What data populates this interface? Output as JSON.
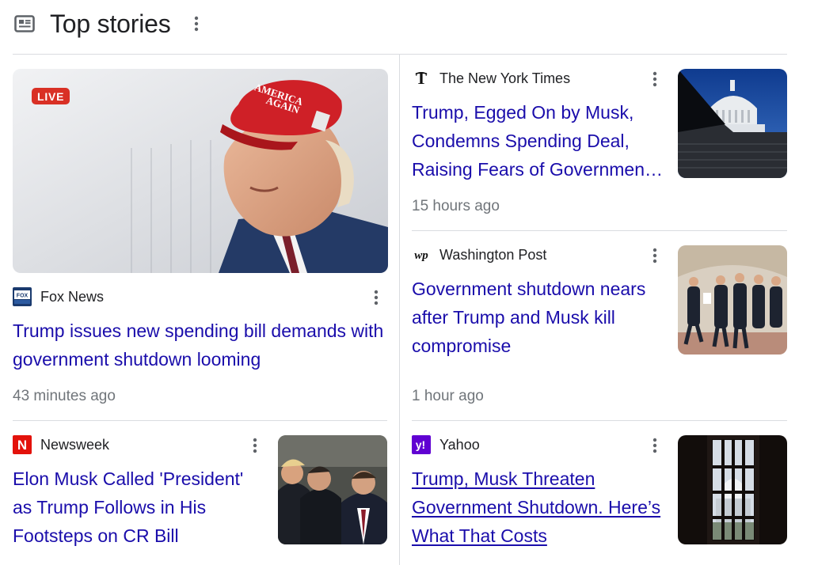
{
  "section": {
    "title": "Top stories",
    "icon": "newspaper-icon"
  },
  "stories": [
    {
      "id": "fox",
      "badge": "LIVE",
      "source": "Fox News",
      "source_icon": "fox-news-logo",
      "headline": "Trump issues new spending bill demands with government shutdown looming",
      "time": "43 minutes ago",
      "image": "trump-maga-cap-photo"
    },
    {
      "id": "nyt",
      "source": "The New York Times",
      "source_icon": "nyt-logo",
      "headline": "Trump, Egged On by Musk, Condemns Spending Deal, Raising Fears of Government Shutdown",
      "time": "15 hours ago",
      "image": "capitol-dome-steps-photo"
    },
    {
      "id": "wapo",
      "source": "Washington Post",
      "source_icon": "washington-post-logo",
      "headline": "Government shutdown nears after Trump and Musk kill compromise",
      "time": "1 hour ago",
      "image": "officials-walking-hallway-photo"
    },
    {
      "id": "newsweek",
      "source": "Newsweek",
      "source_icon": "newsweek-logo",
      "headline": "Elon Musk Called 'President' as Trump Follows in His Footsteps on CR Bill",
      "image": "trump-musk-vance-photo"
    },
    {
      "id": "yahoo",
      "source": "Yahoo",
      "source_icon": "yahoo-logo",
      "headline": "Trump, Musk Threaten Government Shutdown. Here’s What That Costs",
      "image": "capitol-through-window-photo"
    }
  ],
  "colors": {
    "link": "#1a0dab",
    "meta": "#70757a",
    "divider": "#dadce0",
    "live": "#d93025"
  }
}
